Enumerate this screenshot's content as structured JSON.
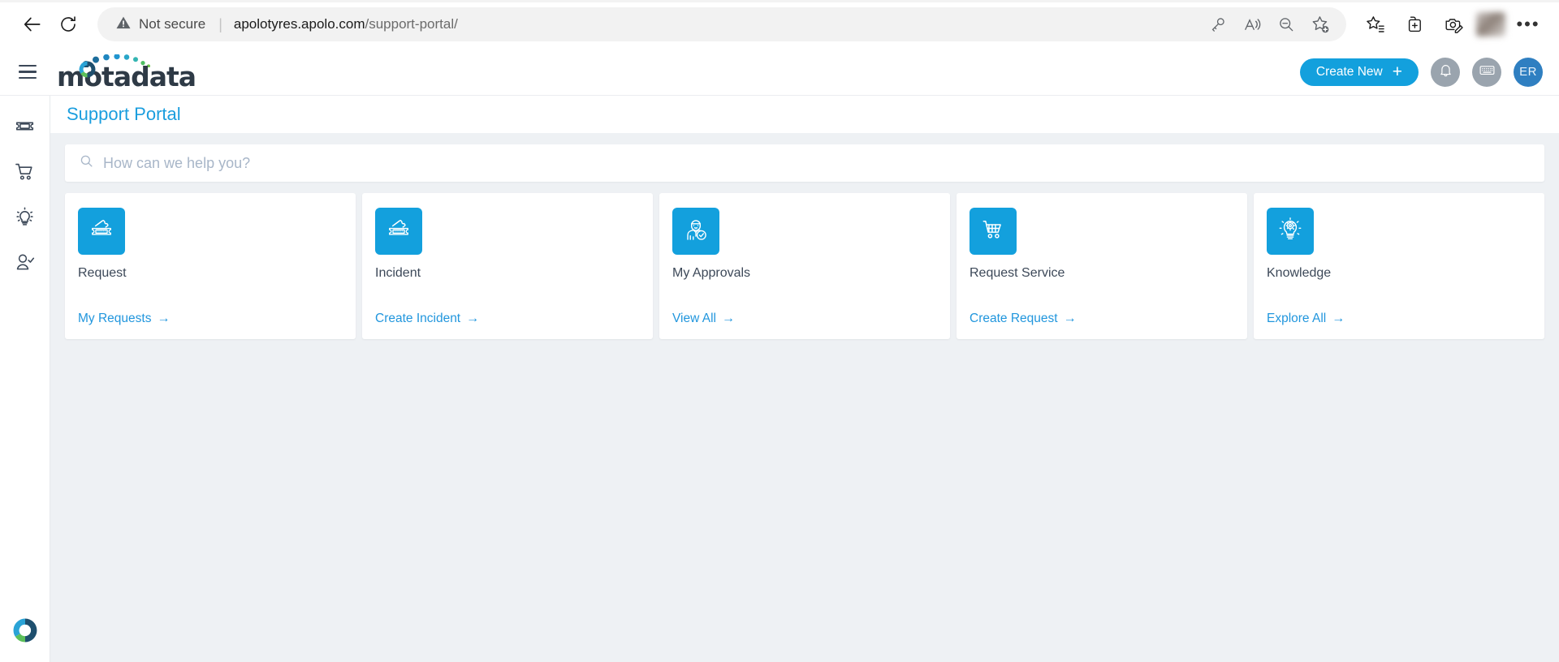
{
  "browser": {
    "back_icon": "back-arrow-icon",
    "reload_icon": "reload-icon",
    "security_label": "Not secure",
    "security_icon": "warning-triangle-icon",
    "url_host": "apolotyres.apolo.com",
    "url_path": "/support-portal/",
    "urlbar_icons": [
      "key-icon",
      "read-aloud-icon",
      "zoom-out-icon",
      "add-favorite-icon"
    ],
    "toolbar_icons": [
      "favorites-icon",
      "collections-icon",
      "screenshot-icon"
    ],
    "profile_label": "profile-avatar",
    "more_label": "•••"
  },
  "app_header": {
    "menu_icon": "hamburger-menu-icon",
    "brand": "motadata",
    "create_new_label": "Create New",
    "create_new_plus": "+",
    "notification_icon": "bell-icon",
    "keyboard_icon": "keyboard-icon",
    "user_initials": "ER"
  },
  "side_rail": {
    "items": [
      {
        "name": "sidebar-item-ticket",
        "icon": "ticket-icon"
      },
      {
        "name": "sidebar-item-cart",
        "icon": "shopping-cart-icon"
      },
      {
        "name": "sidebar-item-knowledge",
        "icon": "lightbulb-icon"
      },
      {
        "name": "sidebar-item-approvals",
        "icon": "user-check-icon"
      }
    ],
    "bottom_logo": "motadata-mark-icon"
  },
  "page": {
    "title": "Support Portal"
  },
  "search": {
    "icon": "search-icon",
    "placeholder": "How can we help you?",
    "value": ""
  },
  "cards": [
    {
      "icon": "ticket-stack-icon",
      "title": "Request",
      "link_label": "My Requests",
      "arrow": "→"
    },
    {
      "icon": "ticket-stack-icon",
      "title": "Incident",
      "link_label": "Create Incident",
      "arrow": "→"
    },
    {
      "icon": "user-approval-icon",
      "title": "My Approvals",
      "link_label": "View All",
      "arrow": "→"
    },
    {
      "icon": "shopping-cart-icon",
      "title": "Request Service",
      "link_label": "Create Request",
      "arrow": "→"
    },
    {
      "icon": "lightbulb-gear-icon",
      "title": "Knowledge",
      "link_label": "Explore All",
      "arrow": "→"
    }
  ],
  "colors": {
    "brand_blue": "#13a0dd",
    "title_blue": "#1b9ede",
    "link_blue": "#2196dd",
    "page_bg": "#eef1f4",
    "rail_icon": "#3c4858",
    "avatar_blue": "#2f7fc1"
  }
}
